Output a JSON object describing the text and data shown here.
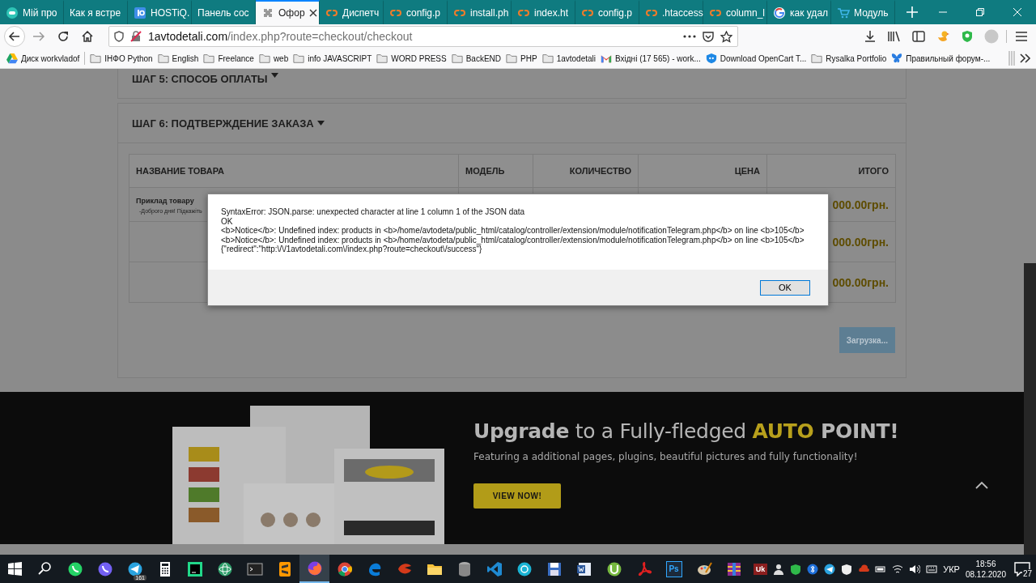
{
  "browser": {
    "tabs": [
      {
        "label": "Мій про",
        "kind": "circle",
        "selected": false
      },
      {
        "label": "Как я встре",
        "kind": "plain",
        "selected": false
      },
      {
        "label": "HOSTiQ.",
        "kind": "square",
        "selected": false
      },
      {
        "label": "Панель сос",
        "kind": "plain",
        "selected": false
      },
      {
        "label": "Офор",
        "kind": "puzzle",
        "selected": true
      },
      {
        "label": "Диспетч",
        "kind": "cpanel",
        "selected": false
      },
      {
        "label": "config.p",
        "kind": "cpanel",
        "selected": false
      },
      {
        "label": "install.ph",
        "kind": "cpanel",
        "selected": false
      },
      {
        "label": "index.ht",
        "kind": "cpanel",
        "selected": false
      },
      {
        "label": "config.p",
        "kind": "cpanel",
        "selected": false
      },
      {
        "label": ".htaccess",
        "kind": "cpanel",
        "selected": false
      },
      {
        "label": "column_l",
        "kind": "cpanel",
        "selected": false
      },
      {
        "label": "как удал",
        "kind": "google",
        "selected": false
      },
      {
        "label": "Модуль",
        "kind": "cart",
        "selected": false
      }
    ],
    "url_host": "1avtodetali.com",
    "url_path": "/index.php?route=checkout/checkout",
    "bookmarks": [
      {
        "label": "Диск workvladof",
        "kind": "drive"
      },
      {
        "label": "ІНФО Python",
        "kind": "folder"
      },
      {
        "label": "English",
        "kind": "folder"
      },
      {
        "label": "Freelance",
        "kind": "folder"
      },
      {
        "label": "web",
        "kind": "folder"
      },
      {
        "label": "info JAVASCRIPT",
        "kind": "folder"
      },
      {
        "label": "WORD PRESS",
        "kind": "folder"
      },
      {
        "label": "BackEND",
        "kind": "folder"
      },
      {
        "label": "PHP",
        "kind": "folder"
      },
      {
        "label": "1avtodetali",
        "kind": "folder"
      },
      {
        "label": "Вхідні (17 565) - work...",
        "kind": "mail"
      },
      {
        "label": "Download OpenCart T...",
        "kind": "shield"
      },
      {
        "label": "Rysalka Portfolio",
        "kind": "folder"
      },
      {
        "label": "Правильный форум-...",
        "kind": "butterfly"
      }
    ]
  },
  "page": {
    "steps": [
      {
        "title": "ШАГ 5: СПОСОБ ОПЛАТЫ"
      },
      {
        "title": "ШАГ 6: ПОДТВЕРЖДЕНИЕ ЗАКАЗА"
      }
    ],
    "table": {
      "columns": [
        "НАЗВАНИЕ ТОВАРА",
        "МОДЕЛЬ",
        "КОЛИЧЕСТВО",
        "ЦЕНА",
        "ИТОГО"
      ],
      "rows": [
        {
          "name": "Приклад товару",
          "note": "-Доброго дня! Підкажіть",
          "total": "000.00грн."
        },
        {
          "total": "000.00грн."
        },
        {
          "total": "000.00грн."
        }
      ]
    },
    "loading_button": "Загрузка..."
  },
  "banner": {
    "headline": [
      {
        "text": "Upgrade",
        "kind": "bold"
      },
      {
        "text": " to a Fully-fledged ",
        "kind": "plain"
      },
      {
        "text": "AUTO",
        "kind": "accent"
      },
      {
        "text": " POINT!",
        "kind": "bold"
      }
    ],
    "subtitle": "Featuring a additional pages, plugins, beautiful pictures and fully functionality!",
    "button": "VIEW NOW!"
  },
  "dialog": {
    "lines": [
      "SyntaxError: JSON.parse: unexpected character at line 1 column 1 of the JSON data",
      "OK",
      "<b>Notice</b>: Undefined index: products in <b>/home/avtodeta/public_html/catalog/controller/extension/module/notificationTelegram.php</b> on line <b>105</b>",
      "<b>Notice</b>: Undefined index: products in <b>/home/avtodeta/public_html/catalog/controller/extension/module/notificationTelegram.php</b> on line <b>105</b>",
      "{\"redirect\":\"http:\\/\\/1avtodetali.com\\/index.php?route=checkout\\/success\"}"
    ],
    "ok": "OK"
  },
  "taskbar": {
    "apps": [
      {
        "kind": "start",
        "active": false
      },
      {
        "kind": "search",
        "active": false
      },
      {
        "kind": "whatsapp",
        "active": false
      },
      {
        "kind": "viber",
        "active": false
      },
      {
        "kind": "telegram",
        "active": false,
        "badge": "161"
      },
      {
        "kind": "calculator",
        "active": false
      },
      {
        "kind": "pycharm",
        "active": false
      },
      {
        "kind": "atom",
        "active": false
      },
      {
        "kind": "terminal",
        "active": false
      },
      {
        "kind": "sublime",
        "active": false
      },
      {
        "kind": "firefox",
        "active": true
      },
      {
        "kind": "chrome",
        "active": false
      },
      {
        "kind": "edge",
        "active": false
      },
      {
        "kind": "filezilla",
        "active": false
      },
      {
        "kind": "explorer",
        "active": false
      },
      {
        "kind": "database",
        "active": false
      },
      {
        "kind": "vscode",
        "active": false
      },
      {
        "kind": "globe",
        "active": false
      },
      {
        "kind": "floppy",
        "active": false
      },
      {
        "kind": "word",
        "active": false
      },
      {
        "kind": "torrent",
        "active": false
      },
      {
        "kind": "pdf",
        "active": false
      },
      {
        "kind": "photoshop",
        "active": false,
        "label": "Ps"
      },
      {
        "kind": "paint",
        "active": false
      },
      {
        "kind": "archive",
        "active": false
      }
    ],
    "tray_label": "Uk",
    "lang": "УКР",
    "time": "18:56",
    "date": "08.12.2020",
    "notifications": "27"
  }
}
